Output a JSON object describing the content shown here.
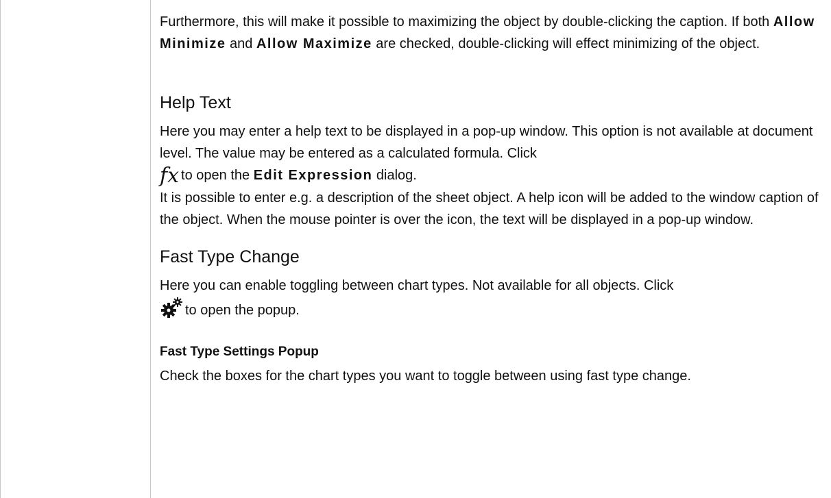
{
  "section_maximize": {
    "p1_part1": "Furthermore, this will make it possible to maximizing the object by double-clicking the caption. If both ",
    "allow_minimize": "Allow Minimize",
    "p1_part2": " and ",
    "allow_maximize": "Allow Maximize",
    "p1_part3": " are checked, double-clicking will effect minimizing of the object."
  },
  "section_help": {
    "heading": "Help Text",
    "p1": "Here you may enter a help text to be displayed in a pop-up window. This option is not available at document level. The value may be entered as a calculated formula. Click",
    "fx_icon": "fx",
    "p1_part2": "to open the ",
    "edit_expression": "Edit Expression",
    "p1_part3": " dialog.",
    "p2": "It is possible to enter e.g. a description of the sheet object. A help icon will be added to the window caption of the object. When the mouse pointer is over the icon, the text will be displayed in a pop-up window."
  },
  "section_fast_type": {
    "heading": "Fast Type Change",
    "p1": "Here you can enable toggling between chart types. Not available for all objects. Click",
    "icon_name": "gear-icon",
    "p1_part2": "to open the popup."
  },
  "section_popup": {
    "heading": "Fast Type Settings Popup",
    "p1": "Check the boxes for the chart types you want to toggle between using fast type change."
  }
}
